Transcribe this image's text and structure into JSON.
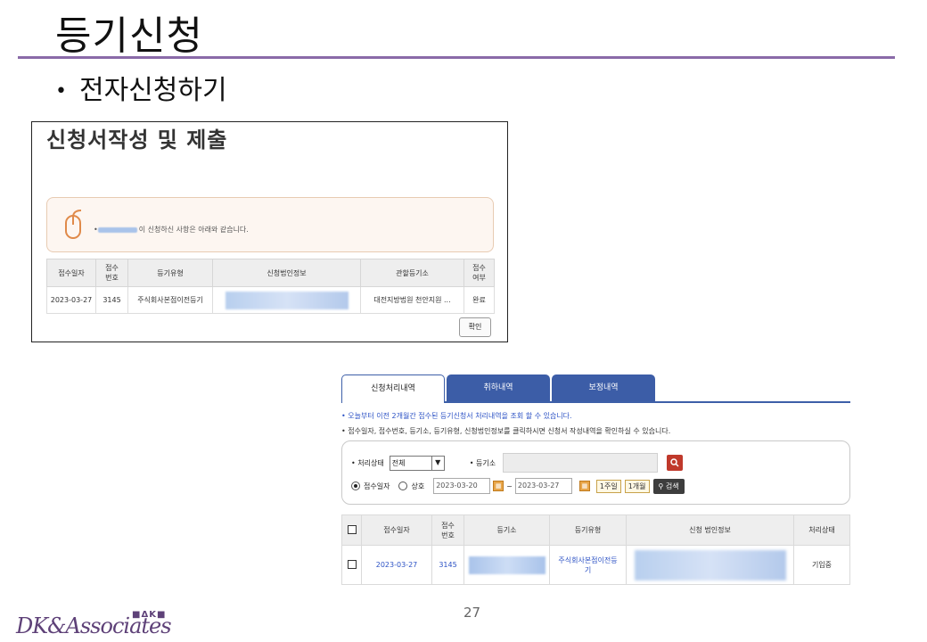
{
  "slide": {
    "title": "등기신청",
    "bullet": "전자신청하기",
    "page_number": "27"
  },
  "screen1": {
    "title": "신청서작성 및 제출",
    "notice": "이 신청하신 사항은 아래와 같습니다.",
    "columns": [
      "접수일자",
      "접수\n번호",
      "등기유형",
      "신청법인정보",
      "관할등기소",
      "접수\n여부"
    ],
    "row": {
      "date": "2023-03-27",
      "number": "3145",
      "type": "주식회사본점이전등기",
      "registry": "대전지방법원 천안지원 ...",
      "status": "완료"
    },
    "confirm_label": "확인"
  },
  "screen2": {
    "tabs": [
      "신청처리내역",
      "취하내역",
      "보정내역"
    ],
    "info1": "오늘부터 이전 2개월간 접수된 등기신청서 처리내역을 조회 할 수 있습니다.",
    "info2": "접수일자, 접수번호, 등기소, 등기유형, 신청법인정보를 클릭하시면 신청서 작성내역을 확인하실 수 있습니다.",
    "search": {
      "status_label": "처리상태",
      "status_value": "전체",
      "registry_label": "등기소",
      "radio_date": "접수일자",
      "radio_name": "상호",
      "date_from": "2023-03-20",
      "date_sep": "~",
      "date_to": "2023-03-27",
      "week_label": "1주일",
      "month_label": "1개월",
      "search_label": "검색"
    },
    "columns": [
      "접수일자",
      "접수\n번호",
      "등기소",
      "등기유형",
      "신청 법인정보",
      "처리상태"
    ],
    "row": {
      "date": "2023-03-27",
      "number": "3145",
      "type": "주식회사본점이전등기",
      "status": "기입중"
    }
  },
  "logo": {
    "text": "DK&Associates",
    "mark": "ΔK"
  },
  "colors": {
    "accent_purple": "#8a6aa8",
    "tab_blue": "#3c5da7",
    "link_blue": "#2c52c5",
    "search_red": "#c0392b"
  }
}
